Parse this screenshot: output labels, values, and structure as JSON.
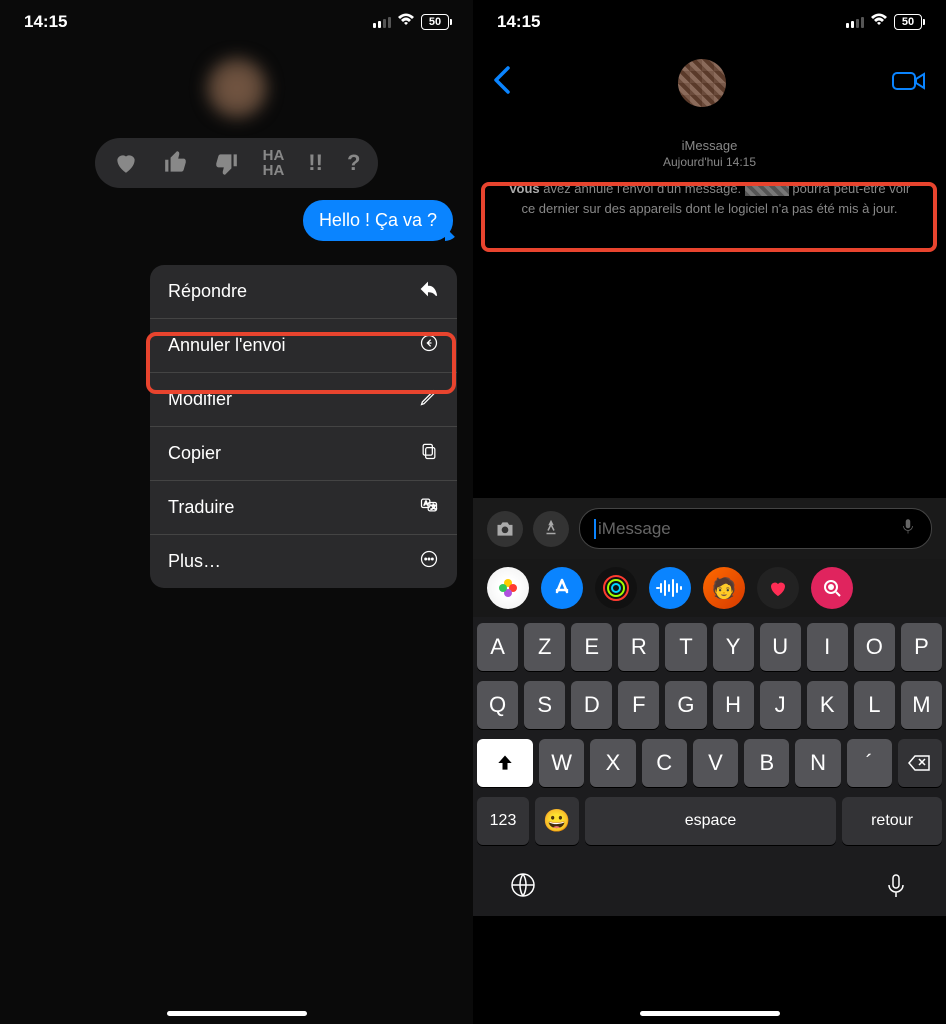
{
  "status": {
    "time": "14:15",
    "battery": "50"
  },
  "left": {
    "message": "Hello ! Ça va ?",
    "reactions": [
      "heart",
      "thumbs-up",
      "thumbs-down",
      "haha",
      "exclaim",
      "question"
    ],
    "menu": [
      {
        "label": "Répondre",
        "icon": "reply"
      },
      {
        "label": "Annuler l'envoi",
        "icon": "undo"
      },
      {
        "label": "Modifier",
        "icon": "edit"
      },
      {
        "label": "Copier",
        "icon": "copy"
      },
      {
        "label": "Traduire",
        "icon": "translate"
      },
      {
        "label": "Plus…",
        "icon": "more"
      }
    ]
  },
  "right": {
    "service_label": "iMessage",
    "timestamp": "Aujourd'hui 14:15",
    "notice_prefix": "Vous",
    "notice_mid1": " avez annulé l'envoi d'un message. ",
    "notice_mid2": " pourra peut-être voir ce dernier sur des appareils dont le logiciel n'a pas été mis à jour.",
    "input_placeholder": "iMessage",
    "keyboard": {
      "row1": [
        "A",
        "Z",
        "E",
        "R",
        "T",
        "Y",
        "U",
        "I",
        "O",
        "P"
      ],
      "row2": [
        "Q",
        "S",
        "D",
        "F",
        "G",
        "H",
        "J",
        "K",
        "L",
        "M"
      ],
      "row3": [
        "W",
        "X",
        "C",
        "V",
        "B",
        "N",
        "´"
      ],
      "num_label": "123",
      "space_label": "espace",
      "return_label": "retour"
    }
  }
}
